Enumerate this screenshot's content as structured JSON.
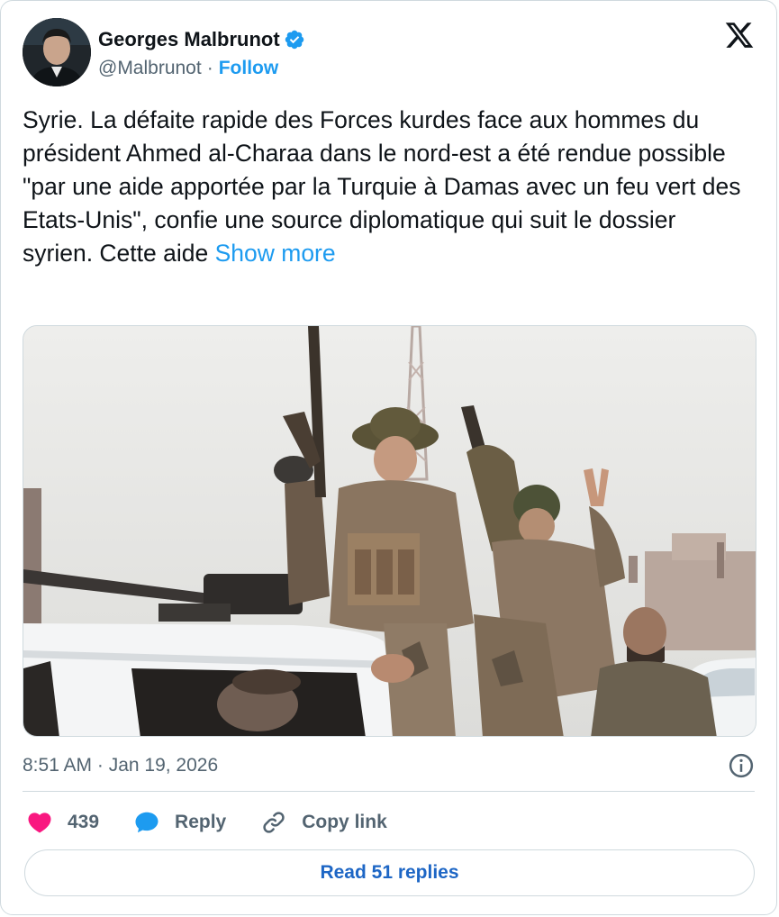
{
  "author": {
    "name": "Georges Malbrunot",
    "handle": "@Malbrunot",
    "separator": "·",
    "follow_label": "Follow",
    "verified_icon": "verified-badge-icon",
    "brand_icon": "x-logo-icon"
  },
  "tweet": {
    "text": "Syrie. La défaite rapide des Forces kurdes face aux hommes du président Ahmed al-Charaa dans le nord-est a été rendue possible \"par une aide apportée par la Turquie à Damas avec un feu vert des Etats-Unis\", confie une source diplomatique qui suit le dossier syrien. Cette aide",
    "show_more_label": "Show more",
    "timestamp": "8:51 AM · Jan 19, 2026"
  },
  "actions": {
    "like_count": "439",
    "reply_label": "Reply",
    "copy_link_label": "Copy link"
  },
  "footer": {
    "read_replies_label": "Read 51 replies"
  },
  "colors": {
    "accent": "#1d9bf0",
    "like": "#f91880",
    "text": "#0f1419",
    "muted": "#536471",
    "border": "#cfd9de"
  }
}
